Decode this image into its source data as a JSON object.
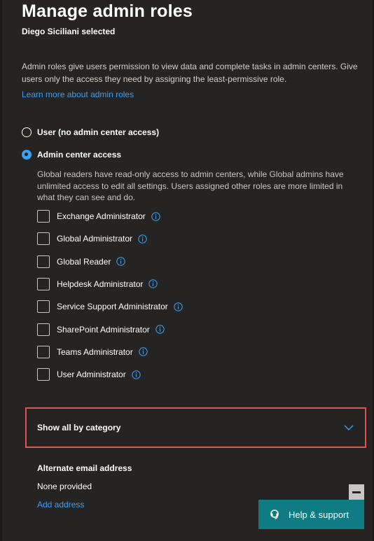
{
  "panel": {
    "title": "Manage admin roles",
    "subtitle": "Diego Siciliani selected",
    "description": "Admin roles give users permission to view data and complete tasks in admin centers. Give users only the access they need by assigning the least-permissive role.",
    "learn_more_link": "Learn more about admin roles"
  },
  "access_options": [
    {
      "label": "User (no admin center access)",
      "selected": false
    },
    {
      "label": "Admin center access",
      "selected": true
    }
  ],
  "roles_description": "Global readers have read-only access to admin centers, while Global admins have unlimited access to edit all settings. Users assigned other roles are more limited in what they can see and do.",
  "roles": [
    {
      "label": "Exchange Administrator",
      "checked": false
    },
    {
      "label": "Global Administrator",
      "checked": false
    },
    {
      "label": "Global Reader",
      "checked": false
    },
    {
      "label": "Helpdesk Administrator",
      "checked": false
    },
    {
      "label": "Service Support Administrator",
      "checked": false
    },
    {
      "label": "SharePoint Administrator",
      "checked": false
    },
    {
      "label": "Teams Administrator",
      "checked": false
    },
    {
      "label": "User Administrator",
      "checked": false
    }
  ],
  "category_toggle": {
    "label": "Show all by category"
  },
  "alternate_email": {
    "heading": "Alternate email address",
    "value": "None provided",
    "add_link": "Add address"
  },
  "help_support": {
    "label": "Help & support"
  },
  "colors": {
    "panel_bg": "#252423",
    "accent_link": "#3aa0f3",
    "highlight_border": "#e05353",
    "help_button_bg": "#0f7b83"
  },
  "icons": {
    "info": "info-icon",
    "chevron": "chevron-down-icon",
    "help": "help-headset-icon",
    "minimize": "minimize-icon"
  }
}
